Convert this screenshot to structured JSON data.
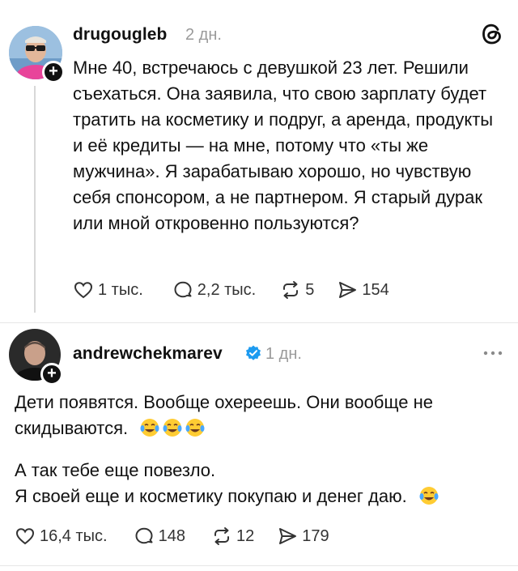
{
  "post1": {
    "username": "drugougleb",
    "time": "2 дн.",
    "text": "Мне 40, встречаюсь с девушкой 23 лет. Решили съехаться. Она заявила, что свою зарплату будет тратить на косметику и подруг, а аренда, продукты и её кредиты — на мне, потому что «ты же мужчина». Я зарабатываю хорошо, но чувствую себя спонсором, а не партнером. Я старый дурак или мной откровенно пользуются?",
    "likes": "1 тыс.",
    "comments": "2,2 тыс.",
    "reposts": "5",
    "shares": "154"
  },
  "post2": {
    "username": "andrewchekmarev",
    "time": "1 дн.",
    "para1": "Дети появятся. Вообще охереешь. Они вообще не скидываются.",
    "para2_line1": "А так тебе еще повезло.",
    "para2_line2": "Я своей еще и косметику покупаю и денег даю.",
    "likes": "16,4 тыс.",
    "comments": "148",
    "reposts": "12",
    "shares": "179"
  },
  "icons": {
    "app_logo": "threads-logo-icon",
    "more": "more-dots-icon",
    "verified": "verified-badge-icon",
    "emoji": "face-with-tears-of-joy-emoji"
  },
  "colors": {
    "verified": "#1d9bf0",
    "muted": "#9a9a9a"
  }
}
